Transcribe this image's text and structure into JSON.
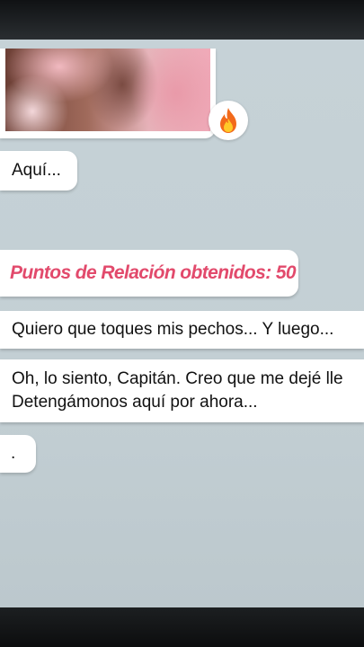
{
  "chat": {
    "photo_reaction_icon": "fire-emoji-icon",
    "messages": [
      {
        "text": "Aquí..."
      },
      {
        "text": "Puntos de Relación obtenidos: 50",
        "icon": "heart-badge-icon",
        "color": "#e24a6c"
      },
      {
        "text": "Quiero que toques mis pechos... Y luego..."
      },
      {
        "line1": "Oh, lo siento, Capitán. Creo que me dejé lle",
        "line2": "Detengámonos aquí por ahora..."
      },
      {
        "text": "."
      }
    ]
  }
}
